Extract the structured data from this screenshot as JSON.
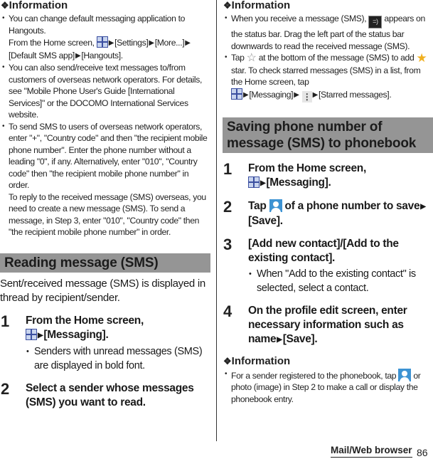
{
  "left": {
    "info_title": "Information",
    "info_items": [
      {
        "text_a": "You can change default messaging application to Hangouts.",
        "text_b": "From the Home screen,",
        "text_c": "[Settings]",
        "text_d": "[More...]",
        "text_e": "[Default SMS app]",
        "text_f": "[Hangouts]."
      },
      {
        "text": "You can also send/receive text messages to/from customers of overseas network operators. For details, see \"Mobile Phone User's Guide [International Services]\" or the DOCOMO International Services website."
      },
      {
        "text_a": "To send SMS to users of overseas network operators, enter \"+\", \"Country code\" and then \"the recipient mobile phone number\". Enter the phone number without a leading \"0\", if any. Alternatively, enter \"010\", \"Country code\" then \"the recipient mobile phone number\" in order.",
        "text_b": "To reply to the received message (SMS) overseas, you need to create a new message (SMS). To send a message, in Step 3, enter \"010\", \"Country code\" then \"the recipient mobile phone number\" in order."
      }
    ],
    "section_title": "Reading message (SMS)",
    "intro": "Sent/received message (SMS) is displayed in thread by recipient/sender.",
    "steps": [
      {
        "num": "1",
        "text_a": "From the Home screen,",
        "text_b": "[Messaging].",
        "sub": "Senders with unread messages (SMS) are displayed in bold font."
      },
      {
        "num": "2",
        "text": "Select a sender whose messages (SMS) you want to read."
      }
    ]
  },
  "right": {
    "info_title": "Information",
    "info_items": [
      {
        "text_a": "When you receive a message (SMS),",
        "text_b": "appears on the status bar. Drag the left part of the status bar downwards to read the received message (SMS)."
      },
      {
        "text_a": "Tap",
        "text_b": "at the bottom of the message (SMS) to add",
        "text_c": "star. To check starred messages (SMS) in a list, from the Home screen, tap",
        "text_d": "[Messaging]",
        "text_e": "[Starred messages]."
      }
    ],
    "section_title": "Saving phone number of message (SMS) to phonebook",
    "steps": [
      {
        "num": "1",
        "text_a": "From the Home screen,",
        "text_b": "[Messaging]."
      },
      {
        "num": "2",
        "text_a": "Tap",
        "text_b": "of a phone number to save",
        "text_c": "[Save]."
      },
      {
        "num": "3",
        "text": "[Add new contact]/[Add to the existing contact].",
        "sub": "When \"Add to the existing contact\" is selected, select a contact."
      },
      {
        "num": "4",
        "text_a": "On the profile edit screen, enter necessary information such as name",
        "text_b": "[Save]."
      }
    ],
    "info2_title": "Information",
    "info2_items": [
      {
        "text_a": "For a sender registered to the phonebook, tap",
        "text_b": "or photo (image) in Step 2 to make a call or display the phonebook entry."
      }
    ]
  },
  "footer": {
    "section": "Mail/Web browser",
    "page": "86"
  },
  "glyphs": {
    "diamond": "❖",
    "arrow": "▶",
    "star_outline": "☆",
    "star": "★",
    "menu": "⋮",
    "msg": "=)"
  }
}
